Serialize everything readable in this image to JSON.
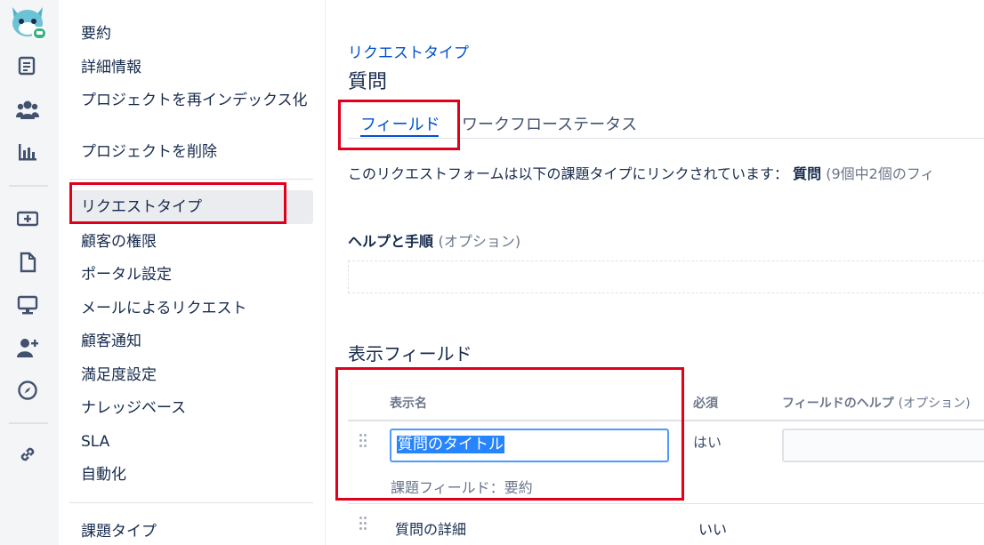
{
  "sidebar": {
    "items_top": [
      "要約",
      "詳細情報",
      "プロジェクトを再インデックス化",
      "プロジェクトを削除"
    ],
    "items_main": [
      "リクエストタイプ",
      "顧客の権限",
      "ポータル設定",
      "メールによるリクエスト",
      "顧客通知",
      "満足度設定",
      "ナレッジベース",
      "SLA",
      "自動化"
    ],
    "items_bottom": [
      "課題タイプ"
    ],
    "selected": "リクエストタイプ"
  },
  "rail_icons": [
    "avatar-icon",
    "document-list-icon",
    "people-icon",
    "chart-icon",
    "add-request-icon",
    "page-icon",
    "monitor-icon",
    "add-user-icon",
    "compass-icon",
    "link-icon"
  ],
  "breadcrumb": "リクエストタイプ",
  "page_title": "質問",
  "tabs": [
    "フィールド",
    "ワークフローステータス"
  ],
  "active_tab": "フィールド",
  "linked": {
    "prefix": "このリクエストフォームは以下の課題タイプにリンクされています：",
    "issue_type": "質問",
    "count_text": "(9個中2個のフィ"
  },
  "help": {
    "title": "ヘルプと手順",
    "optional": "(オプション)"
  },
  "visible_fields_title": "表示フィールド",
  "table": {
    "col_name": "表示名",
    "col_required": "必須",
    "col_help": "フィールドのヘルプ",
    "col_help_optional": "(オプション)",
    "rows": [
      {
        "display_name": "質問のタイトル",
        "field_label": "課題フィールド：要約",
        "required": "はい"
      },
      {
        "display_name": "質問の詳細",
        "required": "いい"
      }
    ]
  },
  "colors": {
    "accent": "#0052cc",
    "highlight": "#e0001b"
  }
}
